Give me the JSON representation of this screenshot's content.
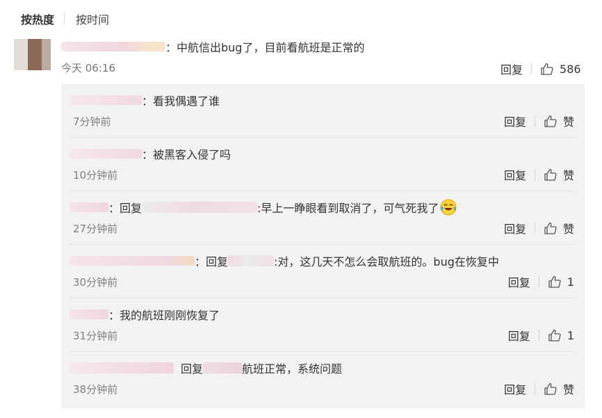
{
  "tabs": {
    "hot": "按热度",
    "time": "按时间"
  },
  "main_comment": {
    "text": "：中航信出bug了，目前看航班是正常的",
    "time": "今天 06:16",
    "reply_label": "回复",
    "likes": "586"
  },
  "replies": [
    {
      "text": "：看我偶遇了谁",
      "time": "7分钟前",
      "reply_label": "回复",
      "likes": "赞"
    },
    {
      "text": "：被黑客入侵了吗",
      "time": "10分钟前",
      "reply_label": "回复",
      "likes": "赞"
    },
    {
      "prefix": "：回复",
      "text": ":早上一睁眼看到取消了，可气死我了",
      "time": "27分钟前",
      "reply_label": "回复",
      "likes": "赞"
    },
    {
      "prefix": "：回复",
      "text": ":对，这几天不怎么会取航班的。bug在恢复中",
      "time": "30分钟前",
      "reply_label": "回复",
      "likes": "1"
    },
    {
      "text": "：我的航班刚刚恢复了",
      "time": "31分钟前",
      "reply_label": "回复",
      "likes": "1"
    },
    {
      "prefix": "回复",
      "text": "航班正常，系统问题",
      "time": "38分钟前",
      "reply_label": "回复",
      "likes": "赞"
    }
  ],
  "colors": {
    "background": "#ffffff",
    "reply_panel": "#f2f2f5",
    "blur_pink": "#f3dde4",
    "blur_gray": "#ececec"
  },
  "icons": {
    "like": "thumbs-up-icon",
    "emoji": "crying-laughing-emoji-icon"
  }
}
